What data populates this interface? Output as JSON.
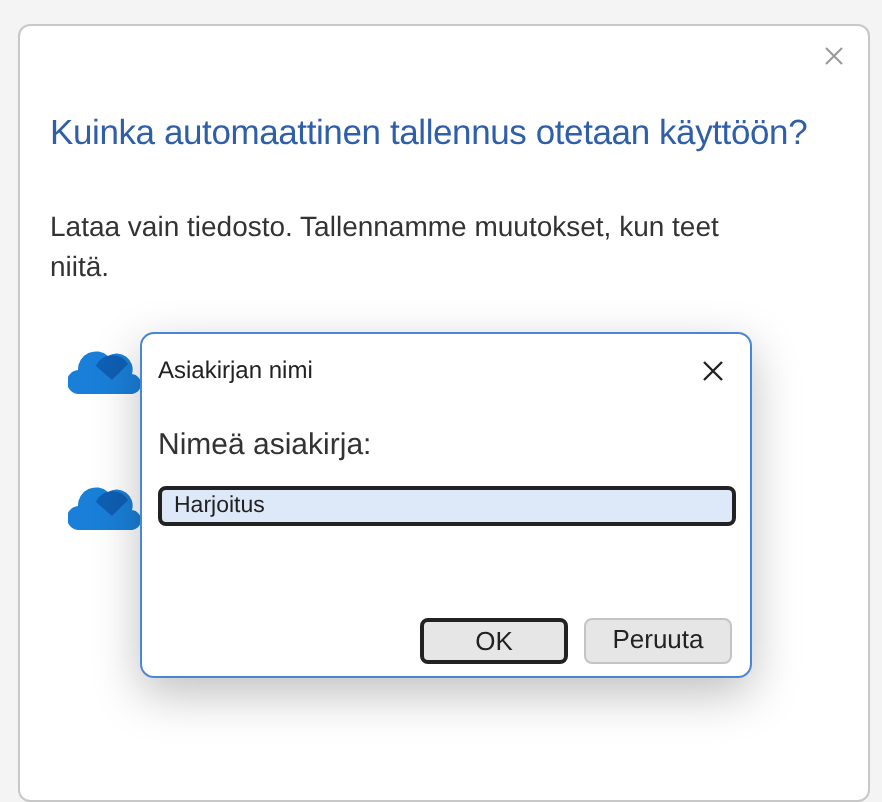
{
  "dialog": {
    "title": "Kuinka automaattinen tallennus otetaan käyttöön?",
    "message": "Lataa vain tiedosto. Tallennamme muutokset, kun teet niitä.",
    "options": [
      {
        "kind": "cloud"
      },
      {
        "kind": "cloud"
      }
    ]
  },
  "prompt": {
    "title": "Asiakirjan nimi",
    "label": "Nimeä asiakirja:",
    "value": "Harjoitus",
    "buttons": [
      {
        "label": "OK",
        "default": true
      },
      {
        "label": "Peruuta",
        "default": false
      }
    ]
  }
}
